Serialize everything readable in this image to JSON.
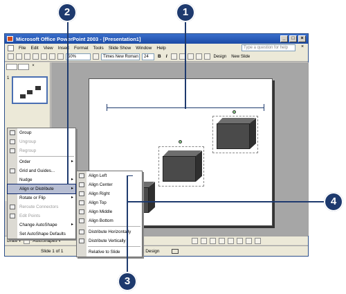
{
  "window": {
    "title": "Microsoft Office PowerPoint 2003 - [Presentation1]",
    "controls": [
      "_",
      "□",
      "×"
    ]
  },
  "menubar": {
    "items": [
      "File",
      "Edit",
      "View",
      "Insert",
      "Format",
      "Tools",
      "Slide Show",
      "Window",
      "Help"
    ],
    "help_placeholder": "Type a question for help",
    "close_doc": "×"
  },
  "toolbar": {
    "zoom": "50%",
    "font": "Times New Roman",
    "size": "24",
    "bold": "B",
    "italic": "I",
    "design": "Design",
    "new_slide": "New Slide"
  },
  "pane": {
    "tab_close": "×",
    "slide_number": "1"
  },
  "context_menu": {
    "items": [
      {
        "label": "Group",
        "disabled": false,
        "submenu": false
      },
      {
        "label": "Ungroup",
        "disabled": true,
        "submenu": false
      },
      {
        "label": "Regroup",
        "disabled": true,
        "submenu": false
      },
      {
        "label": "Order",
        "disabled": false,
        "submenu": true
      },
      {
        "label": "Grid and Guides...",
        "disabled": false,
        "submenu": false
      },
      {
        "label": "Nudge",
        "disabled": false,
        "submenu": true
      },
      {
        "label": "Align or Distribute",
        "disabled": false,
        "submenu": true
      },
      {
        "label": "Rotate or Flip",
        "disabled": false,
        "submenu": true
      },
      {
        "label": "Reroute Connectors",
        "disabled": true,
        "submenu": false
      },
      {
        "label": "Edit Points",
        "disabled": true,
        "submenu": false
      },
      {
        "label": "Change AutoShape",
        "disabled": false,
        "submenu": true
      },
      {
        "label": "Set AutoShape Defaults",
        "disabled": false,
        "submenu": false
      }
    ],
    "arrow": "▸"
  },
  "submenu": {
    "items": [
      "Align Left",
      "Align Center",
      "Align Right",
      "Align Top",
      "Align Middle",
      "Align Bottom",
      "Distribute Horizontally",
      "Distribute Vertically",
      "Relative to Slide"
    ]
  },
  "drawbar": {
    "draw": "Draw ▾",
    "autoshapes": "AutoShapes ▾"
  },
  "status": {
    "slide": "Slide 1 of 1",
    "design": "ult Design"
  },
  "callouts": [
    "1",
    "2",
    "3",
    "4"
  ]
}
